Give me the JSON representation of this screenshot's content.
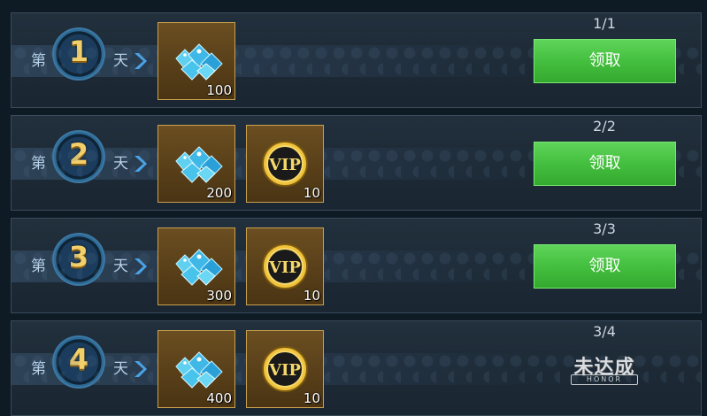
{
  "rows": [
    {
      "day_prefix": "第",
      "day_number": "1",
      "day_suffix": "天",
      "rewards": [
        {
          "icon": "diamond-gems-icon",
          "qty": "100"
        }
      ],
      "progress": "1/1",
      "action_label": "领取",
      "state": "claimable"
    },
    {
      "day_prefix": "第",
      "day_number": "2",
      "day_suffix": "天",
      "rewards": [
        {
          "icon": "diamond-gems-icon",
          "qty": "200"
        },
        {
          "icon": "vip-coin-icon",
          "qty": "10"
        }
      ],
      "progress": "2/2",
      "action_label": "领取",
      "state": "claimable"
    },
    {
      "day_prefix": "第",
      "day_number": "3",
      "day_suffix": "天",
      "rewards": [
        {
          "icon": "diamond-gems-icon",
          "qty": "300"
        },
        {
          "icon": "vip-coin-icon",
          "qty": "10"
        }
      ],
      "progress": "3/3",
      "action_label": "领取",
      "state": "claimable"
    },
    {
      "day_prefix": "第",
      "day_number": "4",
      "day_suffix": "天",
      "rewards": [
        {
          "icon": "diamond-gems-icon",
          "qty": "400"
        },
        {
          "icon": "vip-coin-icon",
          "qty": "10"
        }
      ],
      "progress": "3/4",
      "status_stamp": "未达成",
      "status_stamp_sub": "HONOR",
      "state": "not-reached"
    }
  ],
  "colors": {
    "claim_button": "#44bf3e",
    "badge_number": "#f1cf6a",
    "item_border": "#c9a14e"
  },
  "vip_coin_label": "VIP"
}
